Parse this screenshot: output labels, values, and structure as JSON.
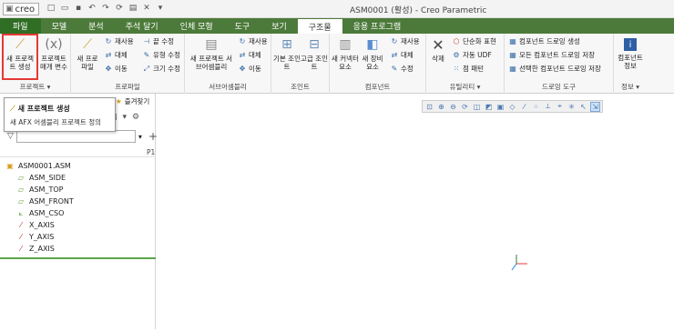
{
  "app": {
    "logo": "creo",
    "window_title": "ASM0001 (활성) - Creo Parametric"
  },
  "ribbon_tabs": [
    "파일",
    "모델",
    "분석",
    "주석 달기",
    "인체 모형",
    "도구",
    "보기",
    "구조물",
    "응용 프로그램"
  ],
  "active_tab": "구조물",
  "groups": {
    "project": {
      "label": "프로젝트 ▾",
      "new_project": "새 프로젝트 생성",
      "project_params": "프로젝트 매개 변수"
    },
    "profile": {
      "label": "프로파일",
      "new_profile": "새 프로 파일",
      "reuse": "재사용",
      "replace": "대체",
      "move": "이동",
      "edit_end": "끝 수정",
      "edit_type": "유형 수정",
      "edit_size": "크기 수정"
    },
    "subassembly": {
      "label": "서브어셈블리",
      "new_project_sub": "새 프로젝트 서브어셈블리",
      "reuse": "재사용",
      "replace": "대체",
      "move": "이동"
    },
    "joint": {
      "label": "조인트",
      "basic_joint": "기본 조인트",
      "advanced_joint": "고급 조인트"
    },
    "component": {
      "label": "컴포넌트",
      "new_connector": "새 커넥터 요소",
      "new_equipment": "새 장비 요소",
      "reuse": "재사용",
      "replace": "대체",
      "edit": "수정"
    },
    "utility": {
      "label": "유틸리티 ▾",
      "delete": "삭제",
      "simplify": "단순화 표현",
      "auto_udf": "자동 UDF",
      "pattern": "점 패턴"
    },
    "drawing_tool": {
      "label": "드로잉 도구",
      "create_comp_drawing": "컴포넌트 드로잉 생성",
      "save_all_comp_drawing": "모든 컴포넌트 드로잉 저장",
      "save_selected_comp_drawing": "선택한 컴포넌트 드로잉 저장"
    },
    "info": {
      "label": "정보 ▾",
      "component_info": "컴포넌트 정보"
    }
  },
  "tooltip": {
    "title": "새 프로젝트 생성",
    "description": "새 AFX 어셈블리 프로젝트 정의"
  },
  "left_panel": {
    "favorites_tab": "즐겨찾기",
    "column_header": "P1",
    "search_placeholder": "",
    "tree": [
      {
        "label": "ASM0001.ASM",
        "icon": "assembly-icon",
        "child": false
      },
      {
        "label": "ASM_SIDE",
        "icon": "datum-plane-icon",
        "child": true
      },
      {
        "label": "ASM_TOP",
        "icon": "datum-plane-icon",
        "child": true
      },
      {
        "label": "ASM_FRONT",
        "icon": "datum-plane-icon",
        "child": true
      },
      {
        "label": "ASM_CSO",
        "icon": "coordinate-system-icon",
        "child": true
      },
      {
        "label": "X_AXIS",
        "icon": "datum-axis-icon",
        "child": true
      },
      {
        "label": "Y_AXIS",
        "icon": "datum-axis-icon",
        "child": true
      },
      {
        "label": "Z_AXIS",
        "icon": "datum-axis-icon",
        "child": true
      }
    ]
  },
  "colors": {
    "tab_bar": "#4c7a3a",
    "file_tab": "#2f6e24",
    "highlight": "#e53935",
    "accent_line": "#5aa64a"
  }
}
